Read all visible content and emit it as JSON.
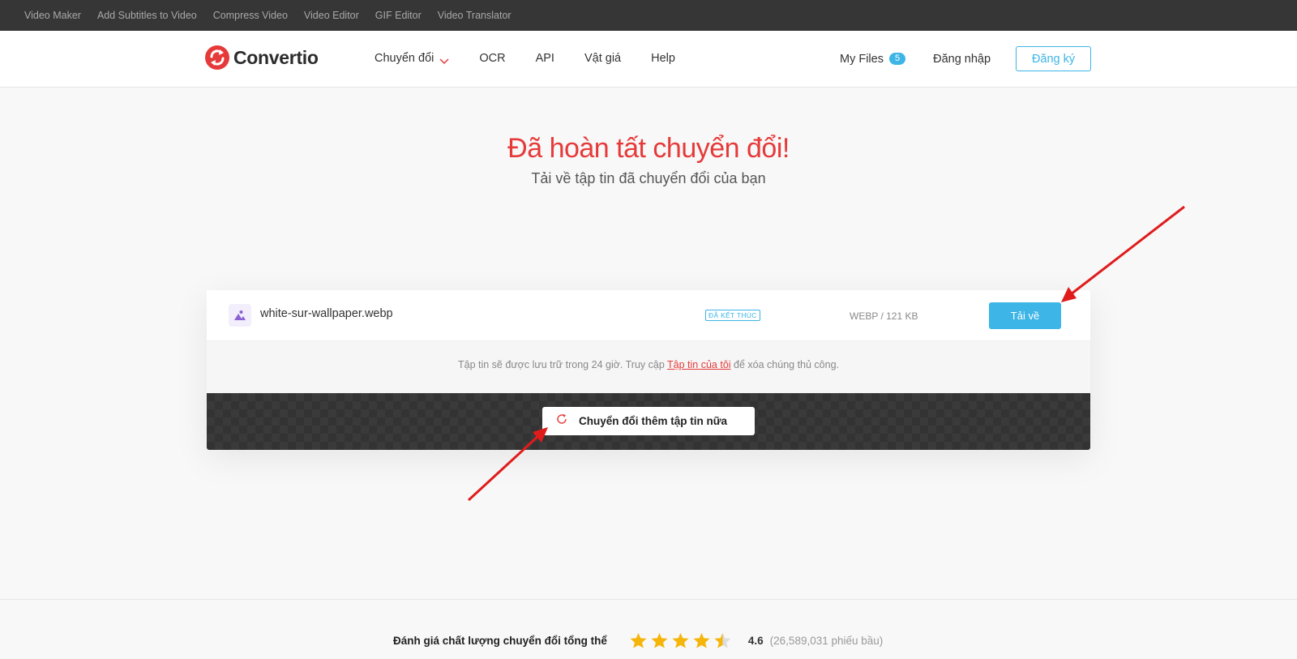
{
  "topbar": {
    "links": [
      "Video Maker",
      "Add Subtitles to Video",
      "Compress Video",
      "Video Editor",
      "GIF Editor",
      "Video Translator"
    ]
  },
  "header": {
    "logo_text": "Convertio",
    "nav": {
      "convert": "Chuyển đổi",
      "ocr": "OCR",
      "api": "API",
      "pricing": "Vật giá",
      "help": "Help"
    },
    "my_files": "My Files",
    "my_files_count": "5",
    "login": "Đăng nhập",
    "signup": "Đăng ký"
  },
  "hero": {
    "title": "Đã hoàn tất chuyển đổi!",
    "subtitle": "Tải về tập tin đã chuyển đổi của bạn"
  },
  "file": {
    "name": "white-sur-wallpaper.webp",
    "status": "ĐÃ KẾT THÚC",
    "info": "WEBP / 121 KB",
    "download_label": "Tải về"
  },
  "note": {
    "before": "Tập tin sẽ được lưu trữ trong 24 giờ. Truy cập ",
    "link": "Tập tin của tôi",
    "after": " để xóa chúng thủ công."
  },
  "actions": {
    "convert_more": "Chuyển đổi thêm tập tin nữa"
  },
  "rating": {
    "label": "Đánh giá chất lượng chuyển đổi tổng thể",
    "stars": 4.5,
    "score": "4.6",
    "votes": "(26,589,031 phiếu bầu)"
  },
  "colors": {
    "accent_red": "#e63a3a",
    "accent_blue": "#3db5e6",
    "star": "#f5b50a",
    "arrow": "#e01b1b"
  },
  "icons": [
    "logo-icon",
    "chevron-down-icon",
    "image-file-icon",
    "refresh-icon",
    "star-icon",
    "arrow-annotation"
  ]
}
